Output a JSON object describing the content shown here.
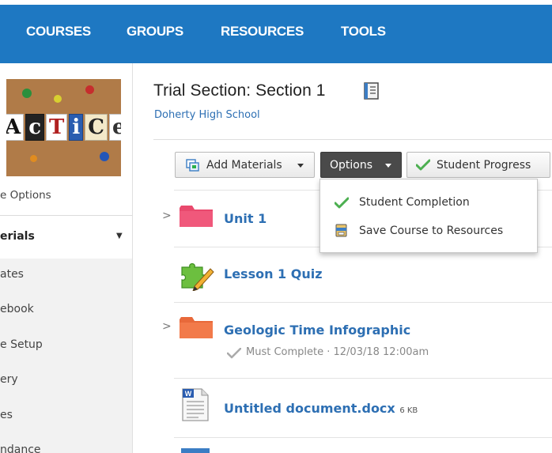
{
  "nav": {
    "items": [
      "COURSES",
      "GROUPS",
      "RESOURCES",
      "TOOLS"
    ]
  },
  "sidebar": {
    "course_picture_letters": "AcTiCe",
    "options_label": "e Options",
    "section_label": "erials",
    "links": [
      "ates",
      "ebook",
      "e Setup",
      "ery",
      "es",
      "ndance"
    ]
  },
  "header": {
    "title": "Trial Section: Section 1",
    "school": "Doherty High School"
  },
  "toolbar": {
    "add_materials": "Add Materials",
    "options": "Options",
    "student_progress": "Student Progress"
  },
  "options_menu": {
    "items": [
      {
        "label": "Student Completion",
        "icon": "green-check-icon"
      },
      {
        "label": "Save Course to Resources",
        "icon": "resources-box-icon"
      }
    ]
  },
  "materials": [
    {
      "title": "Unit 1",
      "icon": "pink-folder-icon",
      "expandable": true
    },
    {
      "title": "Lesson 1 Quiz",
      "icon": "puzzle-pencil-icon",
      "expandable": false
    },
    {
      "title": "Geologic Time Infographic",
      "icon": "orange-folder-icon",
      "expandable": true,
      "meta": "Must Complete · 12/03/18 12:00am"
    },
    {
      "title": "Untitled document.docx",
      "size": "6 KB",
      "icon": "word-document-icon",
      "expandable": false
    }
  ],
  "colors": {
    "nav_bg": "#1e78c2",
    "link": "#2d6fb3",
    "options_button_bg": "#4a4a4a",
    "check_green": "#4caf50",
    "unit_folder": "#e9496d",
    "infographic_folder": "#f27a4a"
  }
}
